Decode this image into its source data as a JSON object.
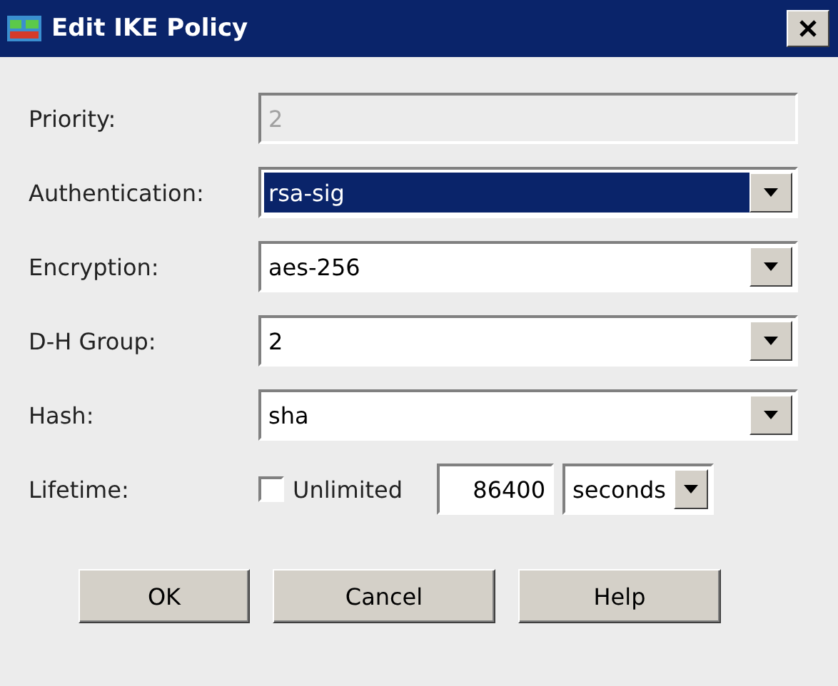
{
  "window": {
    "title": "Edit IKE Policy"
  },
  "fields": [
    {
      "label": "Priority:",
      "kind": "text",
      "value": "2",
      "disabled": true
    },
    {
      "label": "Authentication:",
      "kind": "select",
      "value": "rsa-sig",
      "focused": true
    },
    {
      "label": "Encryption:",
      "kind": "select",
      "value": "aes-256",
      "focused": false
    },
    {
      "label": "D-H Group:",
      "kind": "select",
      "value": "2",
      "focused": false
    },
    {
      "label": "Hash:",
      "kind": "select",
      "value": "sha",
      "focused": false
    }
  ],
  "lifetime": {
    "label": "Lifetime:",
    "unlimited": {
      "label": "Unlimited",
      "checked": false
    },
    "value": "86400",
    "unit": "seconds"
  },
  "buttons": [
    "OK",
    "Cancel",
    "Help"
  ]
}
